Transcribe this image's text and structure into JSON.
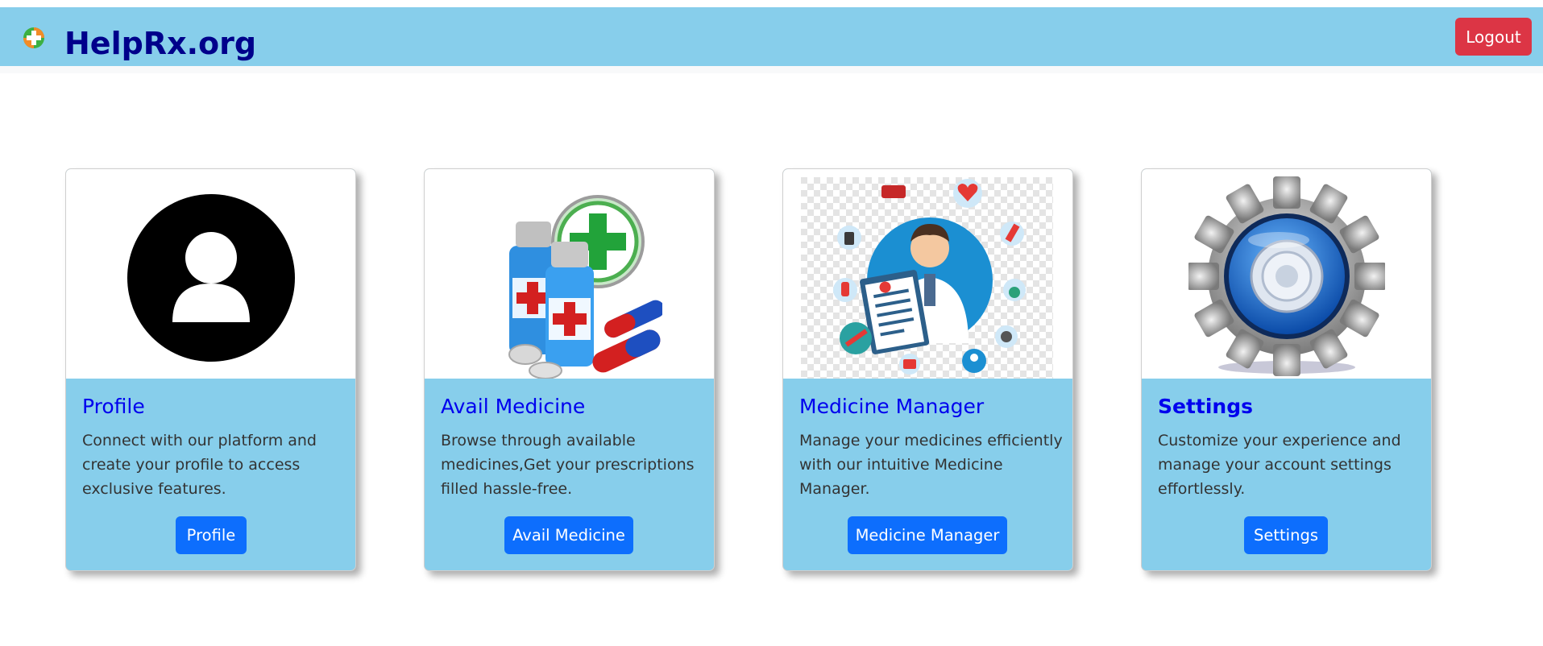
{
  "header": {
    "brand_name": "HelpRx.org",
    "logout_label": "Logout"
  },
  "colors": {
    "navbar_bg": "#87ceeb",
    "brand_text": "#00008b",
    "logout_bg": "#dc3545",
    "card_body_bg": "#87ceeb",
    "card_title": "#0000ee",
    "primary_button": "#0d6efd"
  },
  "cards": [
    {
      "icon": "user-profile-icon",
      "title": "Profile",
      "description": "Connect with our platform and create your profile to access exclusive features.",
      "button_label": "Profile"
    },
    {
      "icon": "medicine-bottles-icon",
      "title": "Avail Medicine",
      "description": "Browse through available medicines,Get your prescriptions filled hassle-free.",
      "button_label": "Avail Medicine"
    },
    {
      "icon": "doctor-clipboard-icon",
      "title": "Medicine Manager",
      "description": "Manage your medicines efficiently with our intuitive Medicine Manager.",
      "button_label": "Medicine Manager"
    },
    {
      "icon": "settings-gear-icon",
      "title": "Settings",
      "description": "Customize your experience and manage your account settings effortlessly.",
      "button_label": "Settings"
    }
  ]
}
